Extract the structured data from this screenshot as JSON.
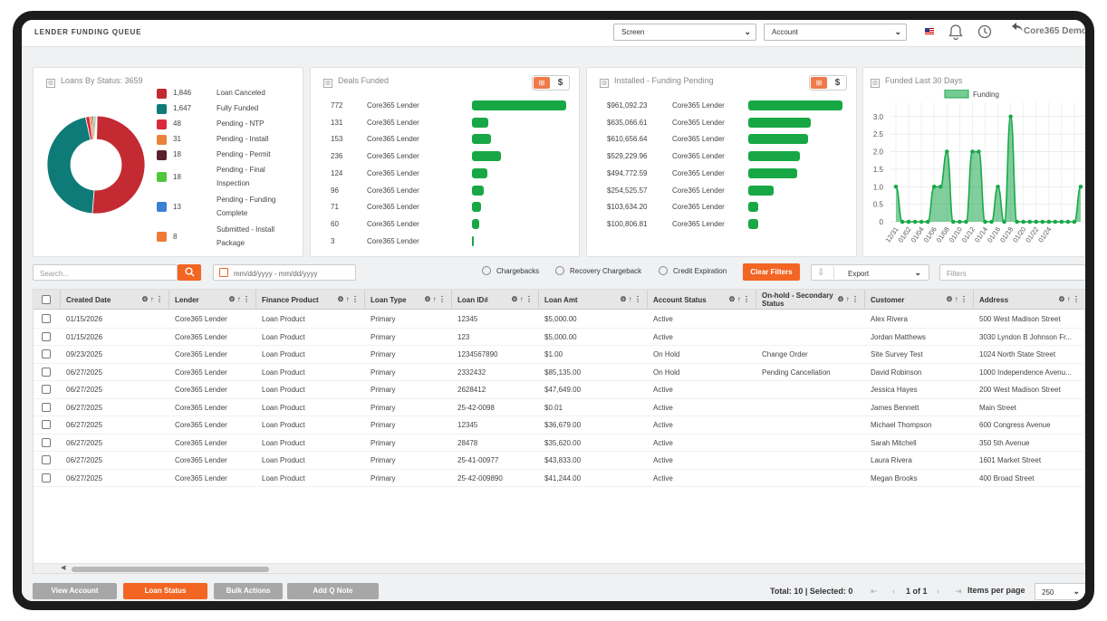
{
  "header": {
    "title": "LENDER FUNDING QUEUE",
    "screen_select": "Screen",
    "account_select": "Account",
    "user_name": "Core365 Demo"
  },
  "donut_card": {
    "title": "Loans By Status: 3659"
  },
  "loan_status": [
    {
      "count": "1,846",
      "label": "Loan Canceled",
      "color": "#c42a32"
    },
    {
      "count": "1,647",
      "label": "Fully Funded",
      "color": "#0f7b78"
    },
    {
      "count": "48",
      "label": "Pending - NTP",
      "color": "#d9283d"
    },
    {
      "count": "31",
      "label": "Pending - Install",
      "color": "#e8843a"
    },
    {
      "count": "18",
      "label": "Pending - Permit",
      "color": "#5a1f2c"
    },
    {
      "count": "18",
      "label": "Pending - Final Inspection",
      "color": "#4fc83c"
    },
    {
      "count": "13",
      "label": "Pending - Funding Complete",
      "color": "#3d7fd6"
    },
    {
      "count": "8",
      "label": "Submitted - Install Package",
      "color": "#ef7a35"
    }
  ],
  "deals_card": {
    "title": "Deals Funded",
    "toggle_dollar": "$"
  },
  "deals": [
    {
      "value": "772",
      "lender": "Core365 Lender",
      "num": 772
    },
    {
      "value": "131",
      "lender": "Core365 Lender",
      "num": 131
    },
    {
      "value": "153",
      "lender": "Core365 Lender",
      "num": 153
    },
    {
      "value": "236",
      "lender": "Core365 Lender",
      "num": 236
    },
    {
      "value": "124",
      "lender": "Core365 Lender",
      "num": 124
    },
    {
      "value": "96",
      "lender": "Core365 Lender",
      "num": 96
    },
    {
      "value": "71",
      "lender": "Core365 Lender",
      "num": 71
    },
    {
      "value": "60",
      "lender": "Core365 Lender",
      "num": 60
    },
    {
      "value": "3",
      "lender": "Core365 Lender",
      "num": 3
    }
  ],
  "installed_card": {
    "title": "Installed - Funding Pending",
    "toggle_dollar": "$"
  },
  "installed": [
    {
      "value": "$961,092.23",
      "lender": "Core365 Lender",
      "num": 961092.23
    },
    {
      "value": "$635,066.61",
      "lender": "Core365 Lender",
      "num": 635066.61
    },
    {
      "value": "$610,656.64",
      "lender": "Core365 Lender",
      "num": 610656.64
    },
    {
      "value": "$529,229.96",
      "lender": "Core365 Lender",
      "num": 529229.96
    },
    {
      "value": "$494,772.59",
      "lender": "Core365 Lender",
      "num": 494772.59
    },
    {
      "value": "$254,525.57",
      "lender": "Core365 Lender",
      "num": 254525.57
    },
    {
      "value": "$103,634.20",
      "lender": "Core365 Lender",
      "num": 103634.2
    },
    {
      "value": "$100,806.81",
      "lender": "Core365 Lender",
      "num": 100806.81
    }
  ],
  "funded_card": {
    "title": "Funded Last 30 Days"
  },
  "chart_data": {
    "type": "area",
    "title": "Funded Last 30 Days",
    "series": [
      {
        "name": "Funding",
        "values": [
          1,
          0,
          0,
          0,
          0,
          0,
          1,
          1,
          2,
          0,
          0,
          0,
          2,
          2,
          0,
          0,
          1,
          0,
          3,
          0,
          0,
          0,
          0,
          0,
          0,
          0,
          0,
          0,
          0,
          1
        ]
      }
    ],
    "x": [
      "12/31",
      "01/01",
      "01/02",
      "01/03",
      "01/04",
      "01/05",
      "01/06",
      "01/07",
      "01/08",
      "01/09",
      "01/10",
      "01/11",
      "01/12",
      "01/13",
      "01/14",
      "01/15",
      "01/16",
      "01/17",
      "01/18",
      "01/19",
      "01/20",
      "01/21",
      "01/22",
      "01/23",
      "01/24",
      "01/25",
      "01/26",
      "01/27",
      "01/28",
      "01/29"
    ],
    "x_tick_labels": [
      "12/31",
      "01/02",
      "01/04",
      "01/06",
      "01/08",
      "01/10",
      "01/12",
      "01/14",
      "01/16",
      "01/18",
      "01/20",
      "01/22",
      "01/24"
    ],
    "y_ticks": [
      "0",
      "0.5",
      "1.0",
      "1.5",
      "2.0",
      "2.5",
      "3.0"
    ],
    "ylim": [
      0,
      3.2
    ],
    "legend": "top",
    "grid": true,
    "color": "#1aa84a"
  },
  "filters": {
    "search_placeholder": "Search...",
    "date_placeholder": "mm/dd/yyyy - mm/dd/yyyy",
    "chk_chargebacks": "Chargebacks",
    "chk_recovery": "Recovery Chargeback",
    "chk_credit": "Credit Expiration",
    "clear": "Clear Filters",
    "export": "Export",
    "filters_placeholder": "Filters"
  },
  "columns": [
    "Created Date",
    "Lender",
    "Finance Product",
    "Loan Type",
    "Loan ID#",
    "Loan Amt",
    "Account Status",
    "On-hold - Secondary Status",
    "Customer",
    "Address"
  ],
  "rows": [
    [
      "01/15/2026",
      "Core365 Lender",
      "Loan Product",
      "Primary",
      "12345",
      "$5,000.00",
      "Active",
      "",
      "Alex Rivera",
      "500 West Madison Street"
    ],
    [
      "01/15/2026",
      "Core365 Lender",
      "Loan Product",
      "Primary",
      "123",
      "$5,000.00",
      "Active",
      "",
      "Jordan Matthews",
      "3030 Lyndon B Johnson Fr..."
    ],
    [
      "09/23/2025",
      "Core365 Lender",
      "Loan Product",
      "Primary",
      "1234567890",
      "$1.00",
      "On Hold",
      "Change Order",
      "Site Survey Test",
      "1024 North State Street"
    ],
    [
      "06/27/2025",
      "Core365 Lender",
      "Loan Product",
      "Primary",
      "2332432",
      "$85,135.00",
      "On Hold",
      "Pending Cancellation",
      "David Robinson",
      "1000 Independence Avenu..."
    ],
    [
      "06/27/2025",
      "Core365 Lender",
      "Loan Product",
      "Primary",
      "2628412",
      "$47,649.00",
      "Active",
      "",
      "Jessica Hayes",
      "200 West Madison Street"
    ],
    [
      "06/27/2025",
      "Core365 Lender",
      "Loan Product",
      "Primary",
      "25-42-0098",
      "$0.01",
      "Active",
      "",
      "James Bennett",
      "Main Street"
    ],
    [
      "06/27/2025",
      "Core365 Lender",
      "Loan Product",
      "Primary",
      "12345",
      "$36,679.00",
      "Active",
      "",
      "Michael Thompson",
      "600 Congress Avenue"
    ],
    [
      "06/27/2025",
      "Core365 Lender",
      "Loan Product",
      "Primary",
      "28478",
      "$35,620.00",
      "Active",
      "",
      "Sarah Mitchell",
      "350 5th Avenue"
    ],
    [
      "06/27/2025",
      "Core365 Lender",
      "Loan Product",
      "Primary",
      "25-41-00977",
      "$43,833.00",
      "Active",
      "",
      "Laura Rivera",
      "1601 Market Street"
    ],
    [
      "06/27/2025",
      "Core365 Lender",
      "Loan Product",
      "Primary",
      "25-42-009890",
      "$41,244.00",
      "Active",
      "",
      "Megan Brooks",
      "400 Broad Street"
    ]
  ],
  "footer": {
    "view_account": "View Account",
    "loan_status": "Loan Status",
    "bulk_actions": "Bulk Actions",
    "add_note": "Add Q Note",
    "total": "Total: 10 | Selected: 0",
    "page": "1 of 1",
    "items_label": "Items per page",
    "items_value": "250"
  }
}
